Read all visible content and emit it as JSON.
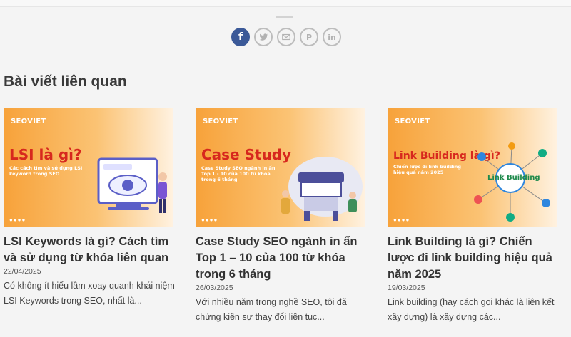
{
  "share": {
    "items": [
      {
        "icon": "facebook-icon",
        "glyph": "f"
      },
      {
        "icon": "twitter-icon",
        "glyph": ""
      },
      {
        "icon": "email-icon",
        "glyph": ""
      },
      {
        "icon": "pinterest-icon",
        "glyph": "P"
      },
      {
        "icon": "linkedin-icon",
        "glyph": "in"
      }
    ]
  },
  "related": {
    "heading": "Bài viết liên quan",
    "posts": [
      {
        "thumb_logo": "SEOVIET",
        "thumb_title": "LSI là gì?",
        "thumb_subtitle": "Các cách tìm và sử dụng LSI keyword trong SEO",
        "title": "LSI Keywords là gì? Cách tìm và sử dụng từ khóa liên quan",
        "date": "22/04/2025",
        "excerpt": "Có không ít hiểu lầm xoay quanh khái niệm LSI Keywords trong SEO, nhất là..."
      },
      {
        "thumb_logo": "SEOVIET",
        "thumb_title": "Case Study",
        "thumb_subtitle": "Case Study SEO ngành in ấn Top 1 - 10 của 100 từ khóa trong 6 tháng",
        "title": "Case Study SEO ngành in ấn Top 1 – 10 của 100 từ khóa trong 6 tháng",
        "date": "26/03/2025",
        "excerpt": "Với nhiều năm trong nghề SEO, tôi đã chứng kiến sự thay đổi liên tục..."
      },
      {
        "thumb_logo": "SEOVIET",
        "thumb_title": "Link Building là gì?",
        "thumb_subtitle": "Chiến lược đi link building hiệu quả năm 2025",
        "thumb_badge": "Link Building",
        "title": "Link Building là gì? Chiến lược đi link building hiệu quả năm 2025",
        "date": "19/03/2025",
        "excerpt": "Link building (hay cách gọi khác là liên kết xây dựng) là xây dựng các..."
      }
    ]
  },
  "colors": {
    "accent_red": "#d7281e",
    "facebook_blue": "#3b5998",
    "orange": "#f7a23a"
  }
}
